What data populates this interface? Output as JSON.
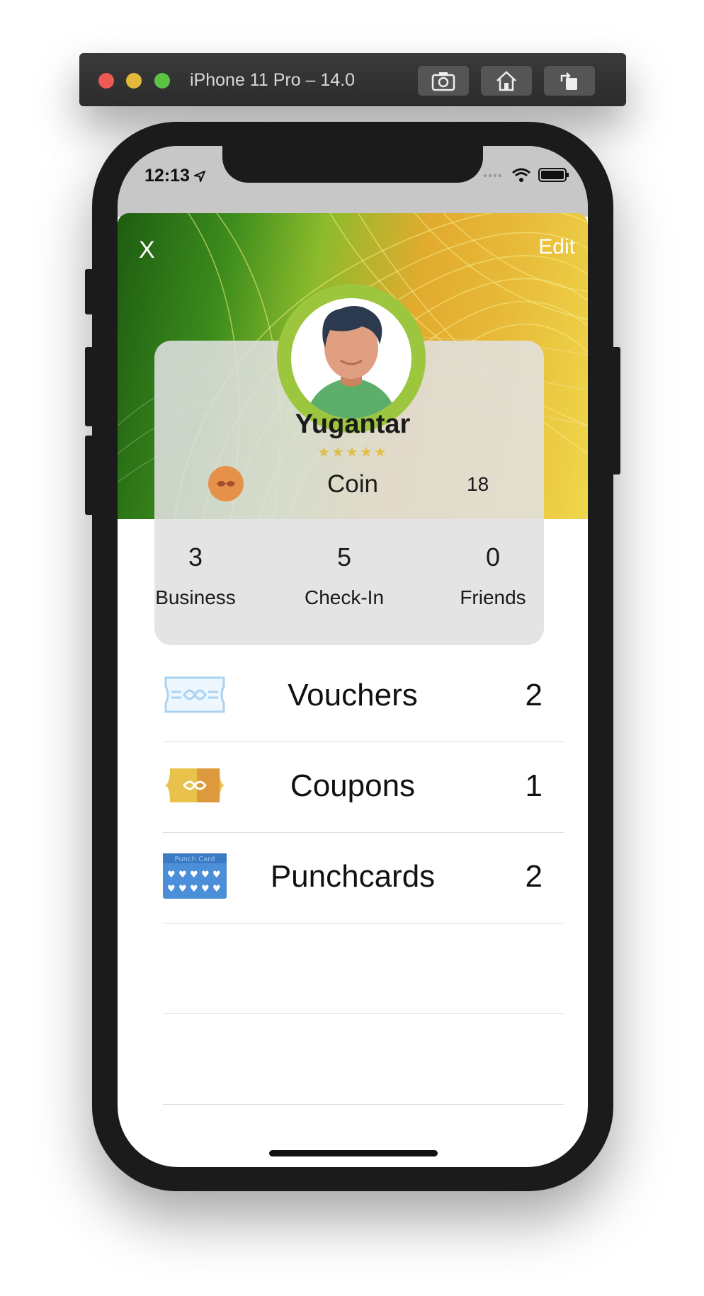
{
  "simulator": {
    "title": "iPhone 11 Pro – 14.0",
    "buttons": [
      "screenshot-icon",
      "home-icon",
      "rotate-icon"
    ]
  },
  "status_bar": {
    "time": "12:13",
    "icons": [
      "location-arrow-icon",
      "signal-icon",
      "wifi-icon",
      "battery-icon"
    ]
  },
  "header": {
    "close_label": "X",
    "edit_label": "Edit"
  },
  "profile": {
    "name": "Yugantar",
    "stars": "★★★★★",
    "coin_label": "Coin",
    "coin_value": "18"
  },
  "stats": [
    {
      "value": "3",
      "label": "Business"
    },
    {
      "value": "5",
      "label": "Check-In"
    },
    {
      "value": "0",
      "label": "Friends"
    }
  ],
  "list": [
    {
      "label": "Vouchers",
      "count": "2",
      "icon": "voucher-icon"
    },
    {
      "label": "Coupons",
      "count": "1",
      "icon": "coupon-icon"
    },
    {
      "label": "Punchcards",
      "count": "2",
      "icon": "punchcard-icon",
      "icon_text": "Punch Card"
    }
  ],
  "colors": {
    "ring": "#9cc63e",
    "coin": "#e6914a",
    "voucher": "#a9d3f2",
    "coupon": "#e8c24a",
    "punchcard": "#4a8fd8"
  }
}
